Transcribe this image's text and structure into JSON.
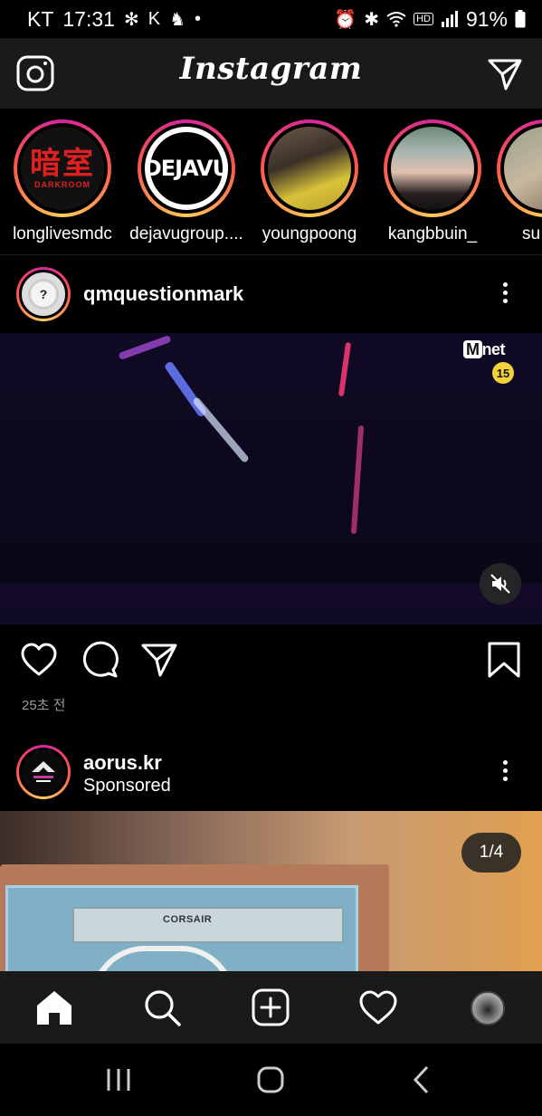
{
  "status_bar": {
    "carrier": "KT",
    "time": "17:31",
    "battery": "91%",
    "hd_label": "HD"
  },
  "header": {
    "logo": "Instagram"
  },
  "stories": [
    {
      "username": "longlivesmdc",
      "avatar_text": "暗室",
      "avatar_subtext": "DARKROOM"
    },
    {
      "username": "dejavugroup....",
      "avatar_text": "DEJAVU"
    },
    {
      "username": "youngpoong"
    },
    {
      "username": "kangbbuin_"
    },
    {
      "username": "su"
    }
  ],
  "posts": [
    {
      "username": "qmquestionmark",
      "avatar_glyph": "?",
      "video": {
        "broadcaster": "net",
        "broadcaster_prefix": "M",
        "rating": "15"
      },
      "timestamp": "25초 전"
    },
    {
      "username": "aorus.kr",
      "subtitle": "Sponsored",
      "image_counter": "1/4",
      "image_brand_text": "CORSAIR"
    }
  ],
  "colors": {
    "background": "#000000",
    "bar": "#1a1a1a",
    "story_ring": "#d6249f",
    "muted_text": "#9a9a9a"
  }
}
